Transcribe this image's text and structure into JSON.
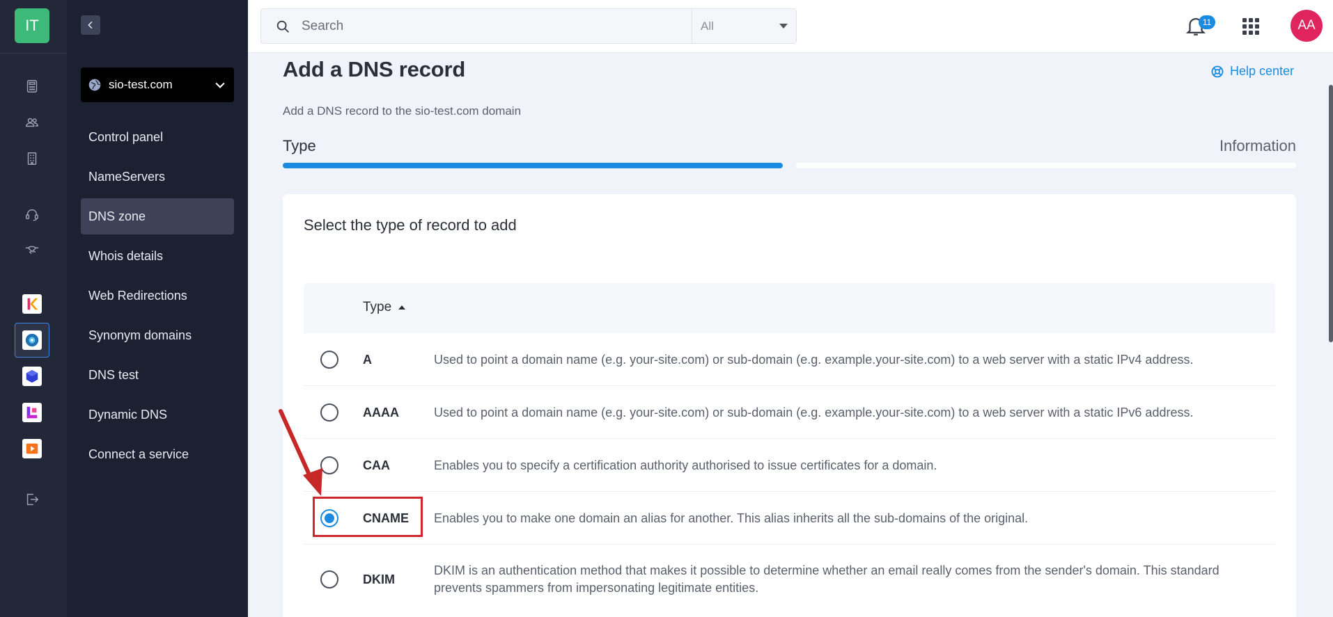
{
  "rail": {
    "logo": "IT",
    "icons": [
      "calculator-icon",
      "users-icon",
      "building-icon",
      "headset-icon",
      "handshake-icon"
    ],
    "apps": [
      "k-app-icon",
      "dns-app-icon",
      "cube-app-icon",
      "l-app-icon",
      "media-app-icon"
    ],
    "logout": "logout-icon"
  },
  "subnav": {
    "domain": "sio-test.com",
    "items": [
      {
        "label": "Control panel"
      },
      {
        "label": "NameServers"
      },
      {
        "label": "DNS zone"
      },
      {
        "label": "Whois details"
      },
      {
        "label": "Web Redirections"
      },
      {
        "label": "Synonym domains"
      },
      {
        "label": "DNS test"
      },
      {
        "label": "Dynamic DNS"
      },
      {
        "label": "Connect a service"
      }
    ],
    "active_index": 2
  },
  "topbar": {
    "search_placeholder": "Search",
    "search_scope": "All",
    "notifications": "11",
    "avatar_initials": "AA"
  },
  "main": {
    "title": "Add a DNS record",
    "help_label": "Help center",
    "subtitle": "Add a DNS record to the sio-test.com domain",
    "steps": [
      {
        "label": "Type"
      },
      {
        "label": "Information"
      }
    ],
    "progress": 0.5,
    "card_title": "Select the type of record to add",
    "column_header": "Type",
    "records": [
      {
        "type": "A",
        "description": "Used to point a domain name (e.g. your-site.com) or sub-domain (e.g. example.your-site.com) to a web server with a static IPv4 address.",
        "selected": false
      },
      {
        "type": "AAAA",
        "description": "Used to point a domain name (e.g. your-site.com) or sub-domain (e.g. example.your-site.com) to a web server with a static IPv6 address.",
        "selected": false
      },
      {
        "type": "CAA",
        "description": "Enables you to specify a certification authority authorised to issue certificates for a domain.",
        "selected": false
      },
      {
        "type": "CNAME",
        "description": "Enables you to make one domain an alias for another. This alias inherits all the sub-domains of the original.",
        "selected": true
      },
      {
        "type": "DKIM",
        "description": "DKIM is an authentication method that makes it possible to determine whether an email really comes from the sender's domain. This standard prevents spammers from impersonating legitimate entities.",
        "selected": false
      }
    ]
  },
  "colors": {
    "accent": "#1a8be0",
    "rail_bg": "#232838",
    "subnav_bg": "#1c2131",
    "highlight": "#d0262e",
    "logo_bg": "#3db97a",
    "avatar_bg": "#e0245e"
  }
}
